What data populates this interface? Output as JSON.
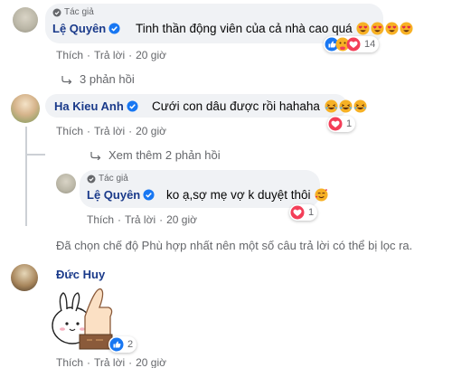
{
  "comments": [
    {
      "author_tag": "Tác giả",
      "name": "Lệ Quyên",
      "text": "Tinh thần động viên của cả nhà cao quá",
      "reaction_count": "14",
      "actions": {
        "like": "Thích",
        "sep": "·",
        "reply": "Trả lời",
        "time": "20 giờ"
      }
    },
    {
      "name": "Ha Kieu Anh",
      "text": "Cưới con dâu được rồi hahaha",
      "reaction_count": "1",
      "actions": {
        "like": "Thích",
        "sep": "·",
        "reply": "Trả lời",
        "time": "20 giờ"
      }
    },
    {
      "author_tag": "Tác giả",
      "name": "Lệ Quyên",
      "text": "ko ạ,sợ mẹ vợ k duyệt thôi",
      "reaction_count": "1",
      "actions": {
        "like": "Thích",
        "sep": "·",
        "reply": "Trả lời",
        "time": "20 giờ"
      }
    },
    {
      "name": "Đức Huy",
      "reaction_count": "2",
      "actions": {
        "like": "Thích",
        "sep": "·",
        "reply": "Trả lời",
        "time": "20 giờ"
      }
    }
  ],
  "replies_link_1": "3 phản hồi",
  "replies_link_2": "Xem thêm 2 phản hồi",
  "filter_notice": "Đã chọn chế độ Phù hợp nhất nên một số câu trả lời có thể bị lọc ra.",
  "colors": {
    "name": "#1a3a8a",
    "meta": "#65676b",
    "bubble": "#f0f2f5",
    "verified": "#1877f2",
    "love": "#f33e58",
    "like": "#1877f2"
  }
}
